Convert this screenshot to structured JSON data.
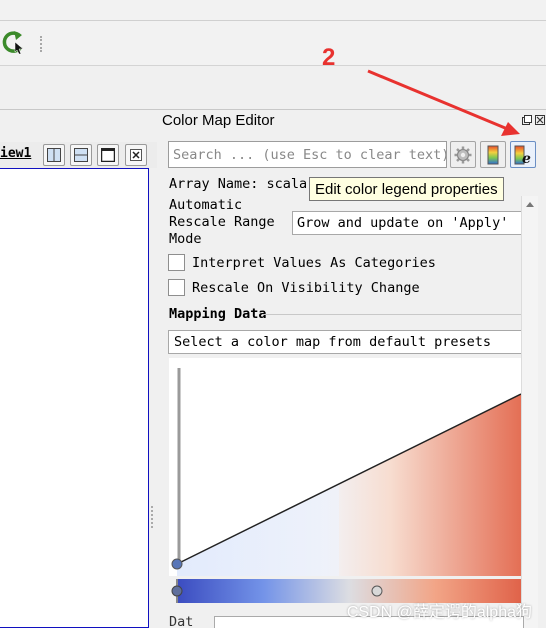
{
  "annotation": {
    "step_number": "2",
    "color": "#e8322f"
  },
  "render_view": {
    "label": "iew1"
  },
  "color_map_editor": {
    "title": "Color Map Editor",
    "search_placeholder": "Search ... (use Esc to clear text)",
    "array_name_label": "Array Name: scalar",
    "tooltip": "Edit color legend properties",
    "rescale_label_line1": "Automatic",
    "rescale_label_line2": "Rescale Range",
    "rescale_label_line3": "Mode",
    "rescale_value": "Grow and update on 'Apply'",
    "interpret_label": "Interpret Values As Categories",
    "rescale_visibility_label": "Rescale On Visibility Change",
    "mapping_data_label": "Mapping Data",
    "presets_combo": "Select a color map from default presets",
    "truncated_label": "Dat"
  },
  "colors": {
    "accent_blue": "#1010c0",
    "cool": "#3b4cc0",
    "warm": "#e0634a"
  },
  "watermark": "CSDN @薛定谔的alpha狗"
}
